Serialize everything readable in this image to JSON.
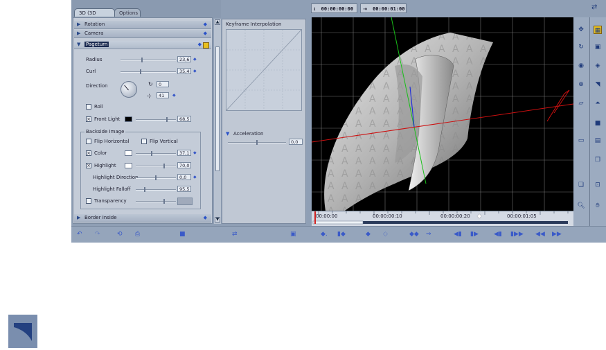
{
  "tabs": {
    "active": "3D (3D Editor)",
    "inactive": "Options"
  },
  "sections": {
    "rotation": "Rotation",
    "camera": "Camera",
    "pageturn": "Pageturn",
    "border_inside": "Border Inside"
  },
  "pageturn": {
    "radius_label": "Radius",
    "radius_value": "23,6",
    "curl_label": "Curl",
    "curl_value": "35,4",
    "direction_label": "Direction",
    "dir_rotation_value": "0",
    "dir_tilt_value": "41",
    "roll_label": "Roll",
    "front_light_label": "Front Light",
    "front_light_value": "68,5"
  },
  "backside": {
    "group_label": "Backside Image",
    "flip_h_label": "Flip Horizontal",
    "flip_v_label": "Flip Vertical",
    "color_label": "Color",
    "color_value": "37,1",
    "highlight_label": "Highlight",
    "highlight_value": "70,0",
    "highlight_direction_label": "Highlight Direction",
    "highlight_direction_value": "0,0",
    "highlight_falloff_label": "Highlight Falloff",
    "highlight_falloff_value": "95,5",
    "transparency_label": "Transparency"
  },
  "keyframe": {
    "title": "Keyframe Interpolation",
    "acceleration_label": "Acceleration",
    "acceleration_value": "0,0"
  },
  "timecode": {
    "start": "00:00:00:00",
    "end": "00:00:01:00"
  },
  "ruler_labels": [
    "00:00:00",
    "00:00:00:10",
    "00:00:00:20",
    "00:00:01:05"
  ],
  "colors": {
    "accent": "#3a5ac8",
    "panel": "#c4ccd8",
    "viewport": "#000000",
    "red_axis": "#cc1010",
    "green_axis": "#18c018",
    "blue_axis": "#2030d8"
  },
  "icons": {
    "move": "move-icon",
    "rotate": "rotate-icon",
    "camera": "camera-icon",
    "zoom": "zoom-icon",
    "hand": "hand-icon"
  }
}
